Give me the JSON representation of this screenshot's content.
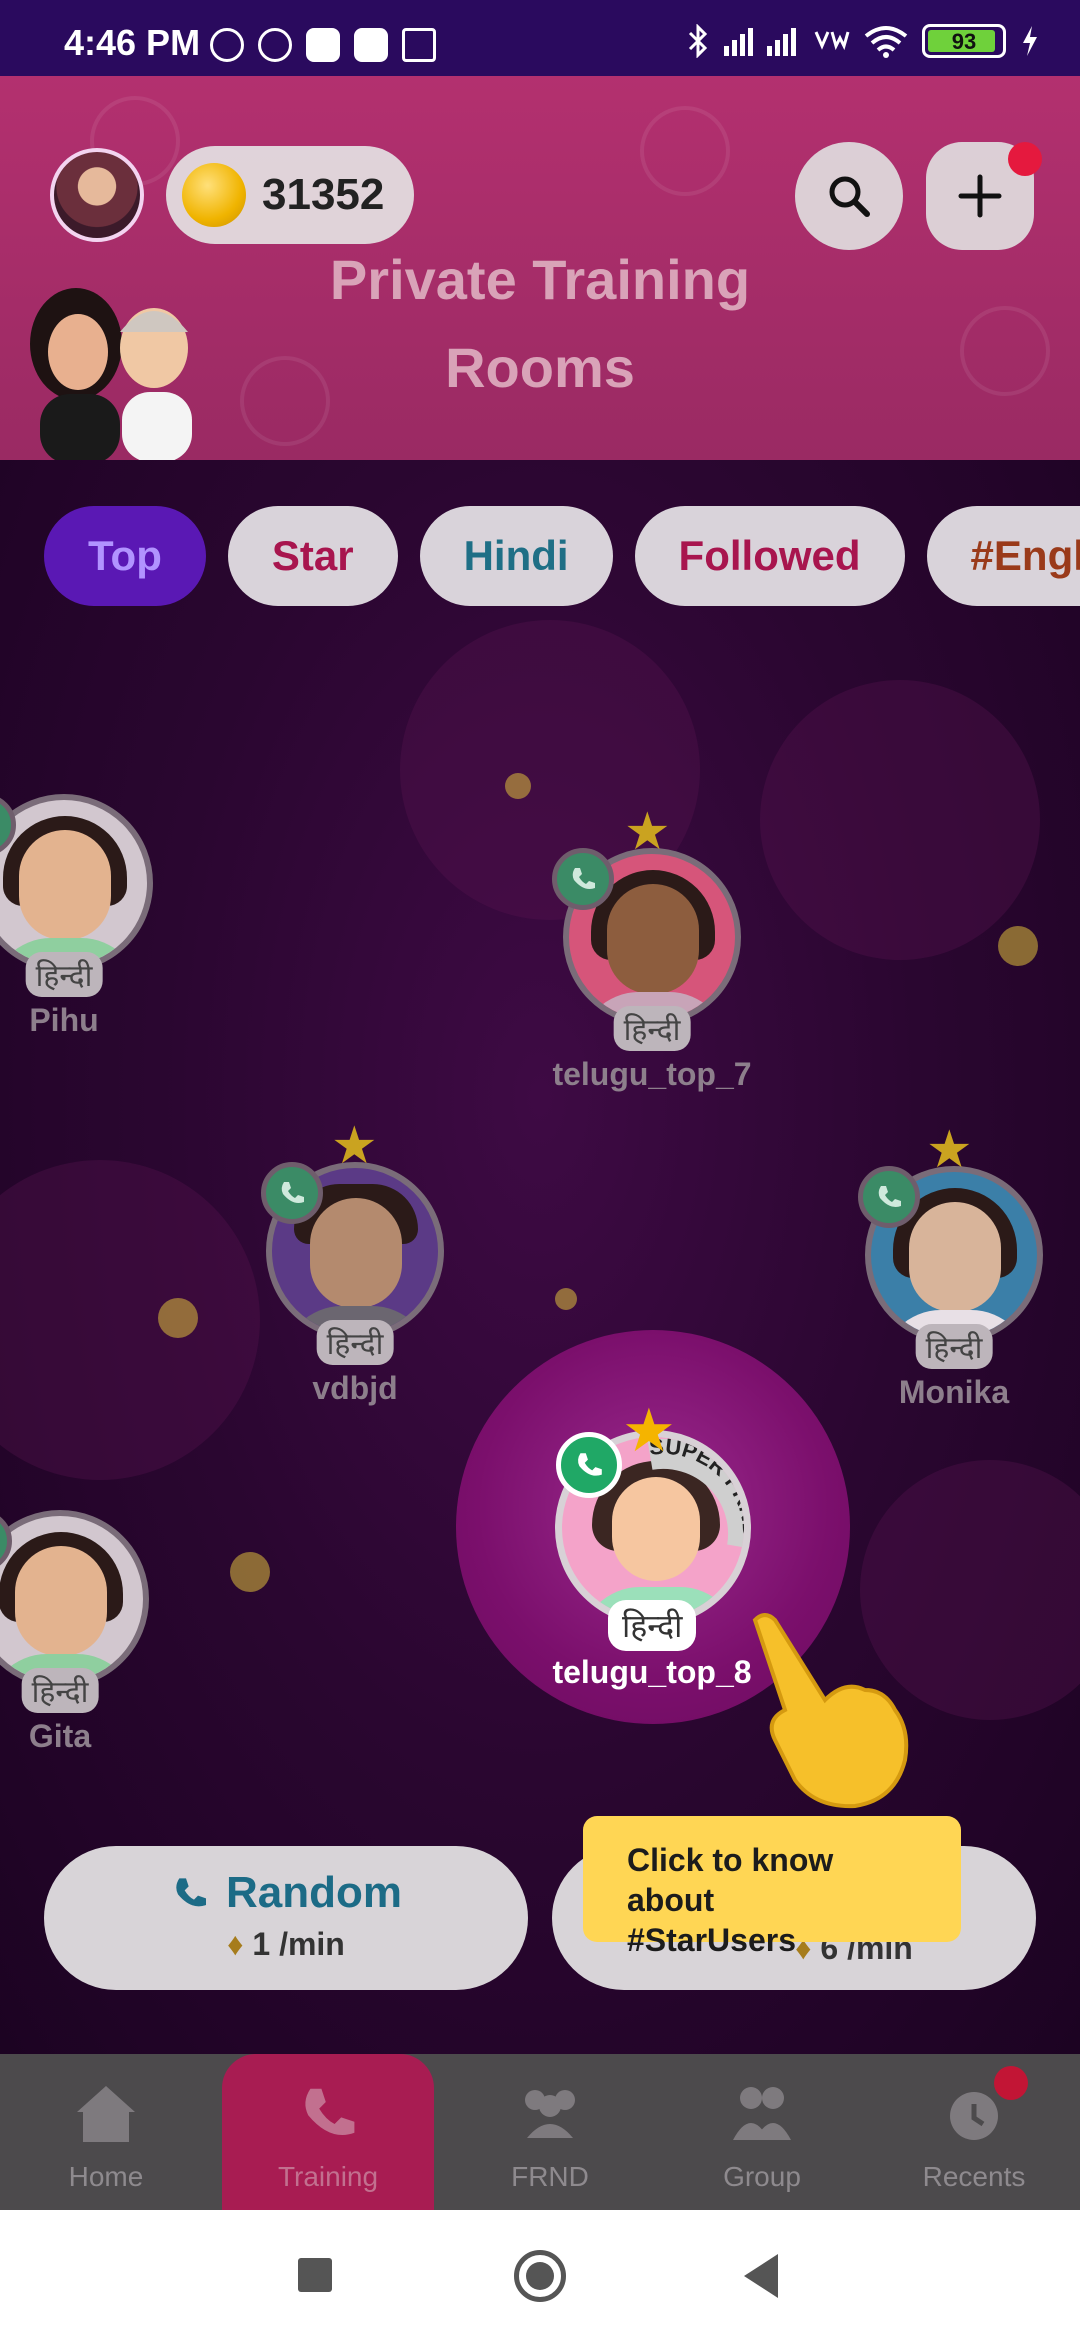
{
  "status_bar": {
    "time": "4:46 PM",
    "battery": "93"
  },
  "header": {
    "coins": "31352",
    "title_line1": "Private Training",
    "title_line2": "Rooms"
  },
  "tabs": [
    {
      "label": "Top",
      "active": true
    },
    {
      "label": "Star",
      "active": false
    },
    {
      "label": "Hindi",
      "active": false
    },
    {
      "label": "Followed",
      "active": false
    },
    {
      "label": "#Engli",
      "active": false
    }
  ],
  "users": [
    {
      "name": "Pihu",
      "lang": "हिन्दी"
    },
    {
      "name": "telugu_top_7",
      "lang": "हिन्दी"
    },
    {
      "name": "vdbjd",
      "lang": "हिन्दी"
    },
    {
      "name": "Monika",
      "lang": "हिन्दी"
    },
    {
      "name": "Gita",
      "lang": "हिन्दी"
    }
  ],
  "highlighted_user": {
    "name": "telugu_top_8",
    "lang": "हिन्दी"
  },
  "badge_text": "SUPER FRND",
  "actions": {
    "random": {
      "label": "Random",
      "price": "1 /min"
    },
    "star": {
      "price": "6 /min"
    }
  },
  "tooltip": {
    "line1": "Click to know about",
    "line2": "#StarUsers"
  },
  "bottom_nav": [
    {
      "label": "Home"
    },
    {
      "label": "Training"
    },
    {
      "label": "FRND"
    },
    {
      "label": "Group"
    },
    {
      "label": "Recents"
    }
  ],
  "colors": {
    "accent": "#a81c52",
    "status_bar": "#2a0a5e",
    "tooltip": "#ffd654"
  }
}
